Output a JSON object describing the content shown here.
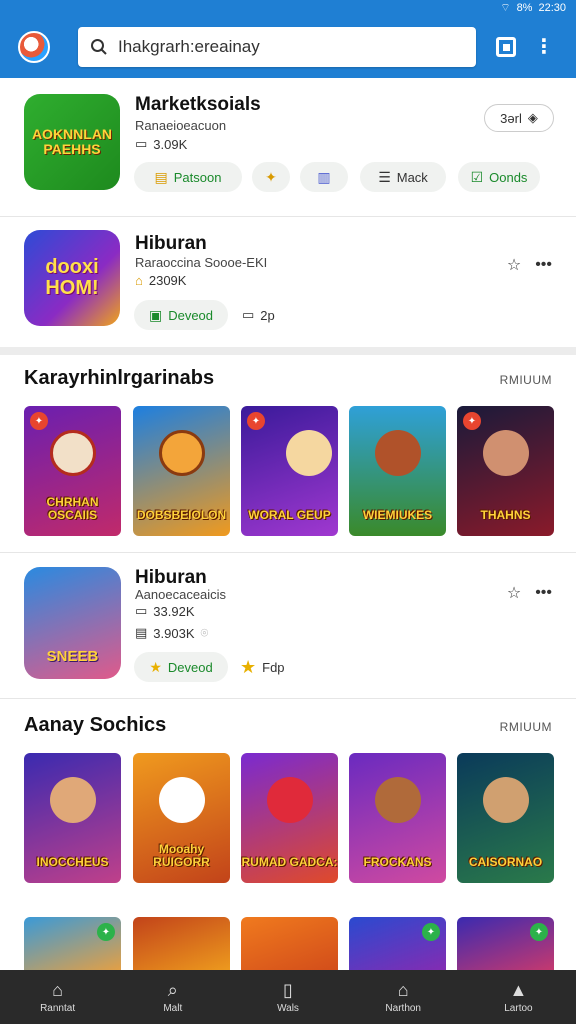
{
  "status": {
    "signal": "⌔",
    "battery": "8%",
    "time": "22:30"
  },
  "search": {
    "value": "Ihakgrarh:ereainay",
    "placeholder": "Ihakgrarh:ereainay"
  },
  "apps": [
    {
      "title": "Marketksoials",
      "subtitle": "Ranaeioeacuon",
      "meta": "3.09K",
      "icon_text": "AOKNNLAN PAEHHS",
      "pill": "3ərl",
      "chips": [
        "Patsoon",
        "",
        "",
        "Mack",
        "Oonds"
      ]
    },
    {
      "title": "Hiburan",
      "subtitle": "Raraoccina Soooe-EKI",
      "meta": "2309K",
      "icon_text": "dooxi HOM!",
      "chips": [
        "Deveod",
        "2p"
      ]
    },
    {
      "title": "Hiburan",
      "subtitle": "Aanoecaceaicis",
      "meta": "33.92K",
      "meta2": "3.903K",
      "icon_text": "SNEEB",
      "chips": [
        "Deveod",
        "Fdp"
      ]
    }
  ],
  "sections": [
    {
      "title": "Karayrhinlrgarinabs",
      "more": "RMIUUM",
      "tiles": [
        "CHRHAN OSCAIIS",
        "DOBSBEIOLON",
        "WORAL GEUP",
        "WIEMIUKES",
        "THAHNS"
      ]
    },
    {
      "title": "Aanay Sochics",
      "more": "RMIUUM",
      "tiles": [
        "INOCCHEUS",
        "Mooahy RUIGORR",
        "RUMAD GADCA:",
        "FROCKANS",
        "CAISORNAO"
      ]
    }
  ],
  "bottom_nav": [
    "Ranntat",
    "Malt",
    "Wals",
    "Narthon",
    "Lartoo"
  ],
  "colors": {
    "accent": "#1f7fd3",
    "nav_bg": "#2a2a2a",
    "chip_green": "#1a8a2b"
  }
}
